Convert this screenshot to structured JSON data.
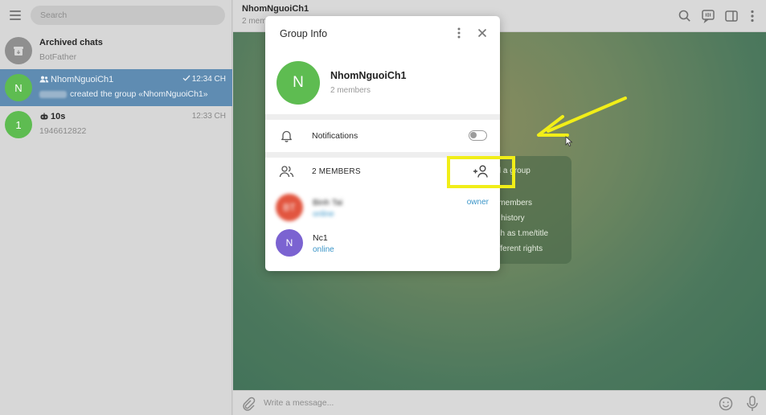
{
  "sidebar": {
    "search_placeholder": "Search",
    "chats": [
      {
        "name": "Archived chats",
        "preview": "BotFather",
        "time": ""
      },
      {
        "avatar": "N",
        "name": "NhomNguoiCh1",
        "preview": "created the group «NhomNguoiCh1»",
        "time": "12:34 CH"
      },
      {
        "avatar": "1",
        "name": "10s",
        "preview": "1946612822",
        "time": "12:33 CH"
      }
    ]
  },
  "chat_header": {
    "title": "NhomNguoiCh1",
    "subtitle": "2 members"
  },
  "info_card": {
    "lines": [
      "ed a group",
      "0 members",
      "nt history",
      "uch as t.me/title",
      "different rights"
    ]
  },
  "composer": {
    "placeholder": "Write a message..."
  },
  "group_info": {
    "title": "Group Info",
    "group_avatar": "N",
    "group_name": "NhomNguoiCh1",
    "group_members": "2 members",
    "notifications_label": "Notifications",
    "members_header": "2 MEMBERS",
    "members": [
      {
        "avatar": "BT",
        "name": "Binh Tai",
        "status": "online",
        "role": "owner",
        "color": "#e2553f"
      },
      {
        "avatar": "N",
        "name": "Nc1",
        "status": "online",
        "role": "",
        "color": "#7b63d1"
      }
    ]
  },
  "colors": {
    "active_chat": "#5f8cb2",
    "link": "#3a95c8",
    "group_avatar": "#5ebc51",
    "highlight": "#f1ee18"
  }
}
